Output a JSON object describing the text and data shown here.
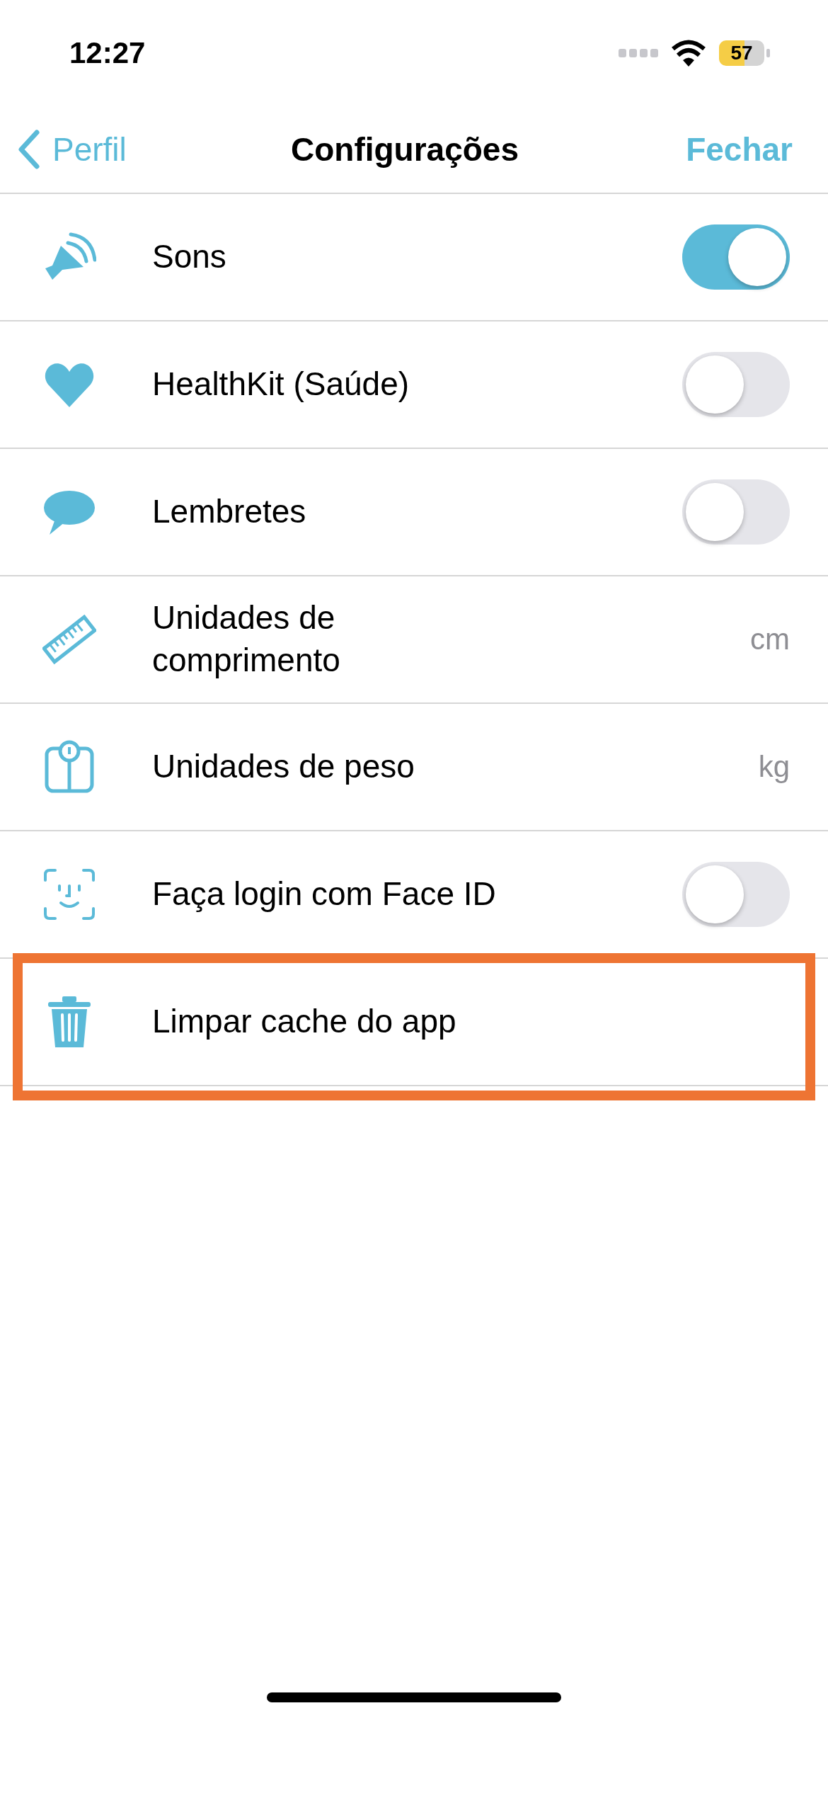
{
  "status_bar": {
    "time": "12:27",
    "battery": "57"
  },
  "nav": {
    "back": "Perfil",
    "title": "Configurações",
    "action": "Fechar"
  },
  "settings": [
    {
      "kind": "toggle",
      "label": "Sons",
      "on": true,
      "highlighted": false
    },
    {
      "kind": "toggle",
      "label": "HealthKit (Saúde)",
      "on": false,
      "highlighted": false
    },
    {
      "kind": "toggle",
      "label": "Lembretes",
      "on": false,
      "highlighted": false
    },
    {
      "kind": "value",
      "label": "Unidades de comprimento",
      "value": "cm",
      "highlighted": false
    },
    {
      "kind": "value",
      "label": "Unidades de peso",
      "value": "kg",
      "highlighted": false
    },
    {
      "kind": "toggle",
      "label": "Faça login com Face ID",
      "on": false,
      "highlighted": false
    },
    {
      "kind": "action",
      "label": "Limpar cache do app",
      "highlighted": true
    }
  ]
}
